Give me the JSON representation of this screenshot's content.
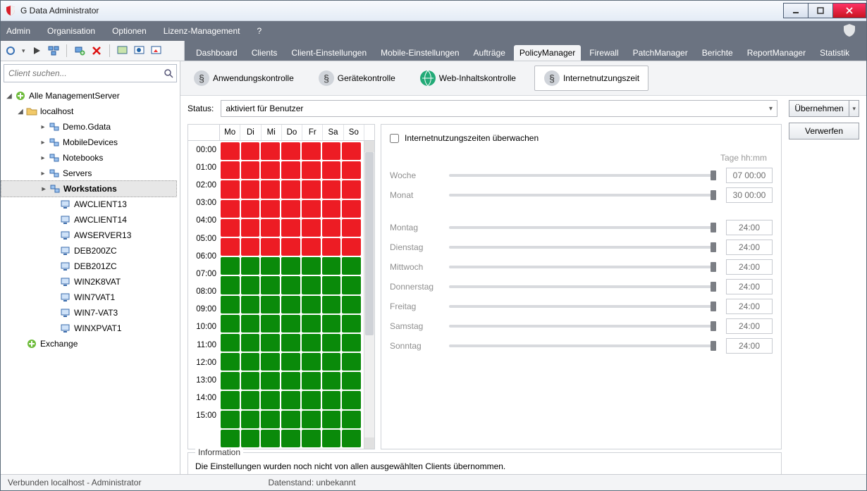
{
  "window": {
    "title": "G Data Administrator"
  },
  "menubar": {
    "items": [
      "Admin",
      "Organisation",
      "Optionen",
      "Lizenz-Management",
      "?"
    ]
  },
  "main_tabs": [
    "Dashboard",
    "Clients",
    "Client-Einstellungen",
    "Mobile-Einstellungen",
    "Aufträge",
    "PolicyManager",
    "Firewall",
    "PatchManager",
    "Berichte",
    "ReportManager",
    "Statistik"
  ],
  "main_tab_active": "PolicyManager",
  "sub_tabs": [
    "Anwendungskontrolle",
    "Gerätekontrolle",
    "Web-Inhaltskontrolle",
    "Internetnutzungszeit"
  ],
  "sub_tab_active": "Internetnutzungszeit",
  "search_placeholder": "Client suchen...",
  "tree": {
    "root": "Alle ManagementServer",
    "host": "localhost",
    "groups": [
      "Demo.Gdata",
      "MobileDevices",
      "Notebooks",
      "Servers",
      "Workstations"
    ],
    "selected": "Workstations",
    "clients": [
      "AWCLIENT13",
      "AWCLIENT14",
      "AWSERVER13",
      "DEB200ZC",
      "DEB201ZC",
      "WIN2K8VAT",
      "WIN7VAT1",
      "WIN7-VAT3",
      "WINXPVAT1"
    ],
    "peer": "Exchange"
  },
  "status": {
    "label": "Status:",
    "value": "aktiviert für Benutzer"
  },
  "buttons": {
    "apply": "Übernehmen",
    "discard": "Verwerfen"
  },
  "grid": {
    "days": [
      "Mo",
      "Di",
      "Mi",
      "Do",
      "Fr",
      "Sa",
      "So"
    ],
    "hours": [
      "00:00",
      "01:00",
      "02:00",
      "03:00",
      "04:00",
      "05:00",
      "06:00",
      "07:00",
      "08:00",
      "09:00",
      "10:00",
      "11:00",
      "12:00",
      "13:00",
      "14:00",
      "15:00"
    ],
    "red_until_hour_index": 6
  },
  "monitor": {
    "checkbox_label": "Internetnutzungszeiten überwachen",
    "tage_label": "Tage hh:mm",
    "summary": [
      {
        "label": "Woche",
        "value": "07 00:00"
      },
      {
        "label": "Monat",
        "value": "30 00:00"
      }
    ],
    "days": [
      {
        "label": "Montag",
        "value": "24:00"
      },
      {
        "label": "Dienstag",
        "value": "24:00"
      },
      {
        "label": "Mittwoch",
        "value": "24:00"
      },
      {
        "label": "Donnerstag",
        "value": "24:00"
      },
      {
        "label": "Freitag",
        "value": "24:00"
      },
      {
        "label": "Samstag",
        "value": "24:00"
      },
      {
        "label": "Sonntag",
        "value": "24:00"
      }
    ]
  },
  "info": {
    "legend": "Information",
    "text": "Die Einstellungen wurden noch nicht von allen ausgewählten Clients übernommen."
  },
  "statusbar": {
    "left": "Verbunden localhost - Administrator",
    "right": "Datenstand: unbekannt"
  }
}
